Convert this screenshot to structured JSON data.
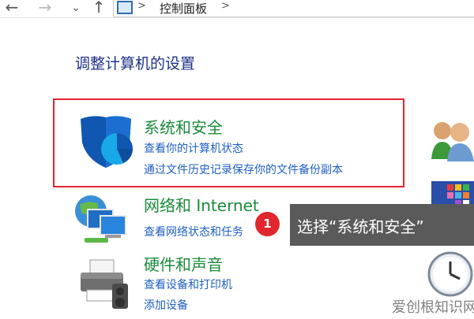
{
  "address_bar": {
    "back_icon": "arrow-left-icon",
    "forward_icon": "arrow-right-icon",
    "recent_icon": "chevron-down-icon",
    "up_icon": "arrow-up-icon",
    "path_icon": "control-panel-icon",
    "separator": ">",
    "breadcrumb": "控制面板"
  },
  "main": {
    "heading": "调整计算机的设置",
    "categories": [
      {
        "title": "系统和安全",
        "icon": "shield-icon",
        "links": [
          "查看你的计算机状态",
          "通过文件历史记录保存你的文件备份副本"
        ]
      },
      {
        "title": "网络和 Internet",
        "icon": "network-monitors-icon",
        "links": [
          "查看网络状态和任务"
        ]
      },
      {
        "title": "硬件和声音",
        "icon": "printer-icon",
        "links": [
          "查看设备和打印机",
          "添加设备"
        ]
      }
    ],
    "right_column_icons": [
      "user-accounts-icon",
      "appearance-icon",
      "clock-icon"
    ]
  },
  "annotation": {
    "step_number": "1",
    "tooltip_text": "选择“系统和安全”",
    "highlight_color": "#e0272e"
  },
  "watermark": {
    "text": "爱创根知识网"
  },
  "colors": {
    "heading": "#1e3287",
    "category_title": "#1a8c3a",
    "link": "#1f5fc2",
    "tooltip_bg": "#5a5a5a"
  }
}
